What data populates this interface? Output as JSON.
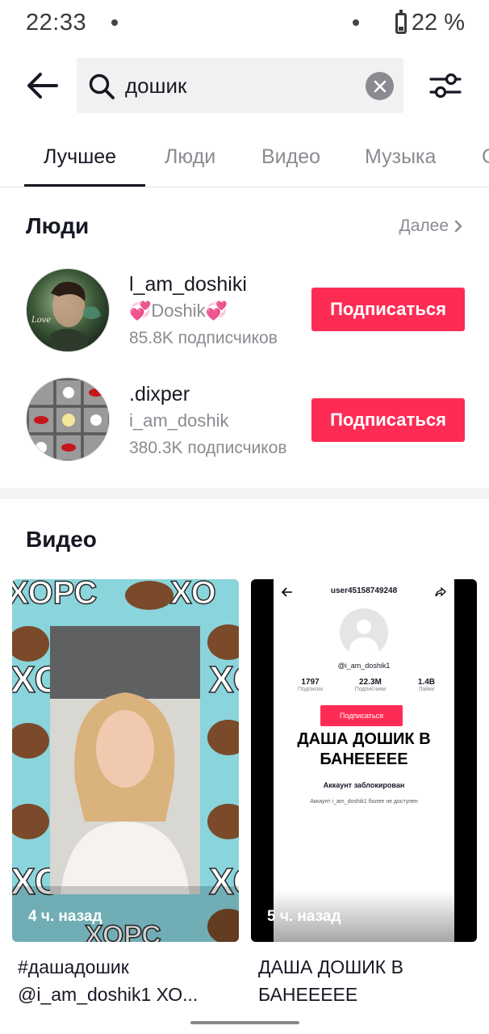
{
  "status_bar": {
    "time": "22:33",
    "battery": "22 %"
  },
  "search": {
    "query": "дошик"
  },
  "tabs": [
    {
      "label": "Лучшее",
      "active": true
    },
    {
      "label": "Люди",
      "active": false
    },
    {
      "label": "Видео",
      "active": false
    },
    {
      "label": "Музыка",
      "active": false
    }
  ],
  "people": {
    "title": "Люди",
    "more": "Далее",
    "users": [
      {
        "username": "l_am_doshiki",
        "nickname": "💞Doshik💞",
        "followers": "85.8K подписчиков",
        "button": "Подписаться"
      },
      {
        "username": ".dixper",
        "nickname": "i_am_doshik",
        "followers": "380.3K подписчиков",
        "button": "Подписаться"
      }
    ]
  },
  "videos": {
    "title": "Видео",
    "items": [
      {
        "time_ago": "4 ч. назад",
        "caption": "#дашадошик @i_am_doshik1 ХО...",
        "overlay_word": "ХОРС"
      },
      {
        "time_ago": "5 ч. назад",
        "caption": "ДАША ДОШИК В БАНЕЕЕЕЕ",
        "profile": {
          "header": "user45158749248",
          "handle": "@i_am_doshik1",
          "stats": [
            {
              "value": "1797",
              "label": "Подписки"
            },
            {
              "value": "22.3M",
              "label": "Подписчики"
            },
            {
              "value": "1.4B",
              "label": "Лайки"
            }
          ],
          "follow": "Подписаться",
          "headline": "ДАША ДОШИК В БАНЕЕЕЕЕ",
          "blocked": "Аккаунт заблокирован",
          "blocked_note": "Аккаунт i_am_doshik1 более не доступен"
        }
      }
    ]
  },
  "colors": {
    "accent": "#fe2c55",
    "text": "#161823",
    "secondary": "#8a8b91",
    "video_bg": "#8ad4dc"
  }
}
